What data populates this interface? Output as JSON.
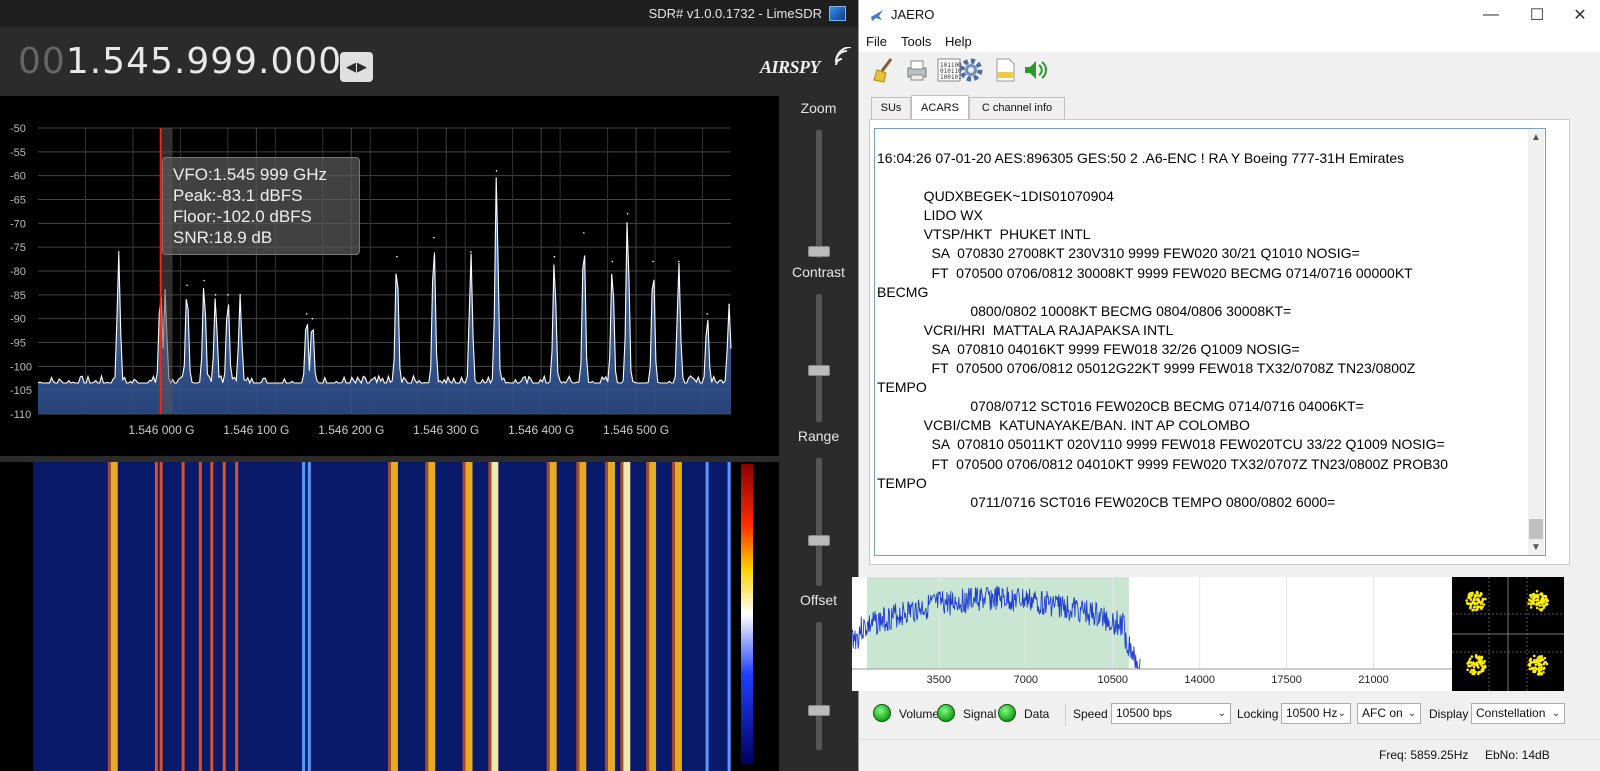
{
  "sdr": {
    "title": "SDR# v1.0.0.1732 - LimeSDR",
    "freq_dim": "00",
    "freq_main": "1.545.999.000",
    "logo": "AIRSPY",
    "vfo_info": {
      "vfo": "VFO:1.545 999 GHz",
      "peak": "Peak:-83.1 dBFS",
      "floor": "Floor:-102.0 dBFS",
      "snr": "SNR:18.9 dB"
    },
    "sliders": [
      {
        "label": "Zoom",
        "value": 0.02
      },
      {
        "label": "Contrast",
        "value": 0.4
      },
      {
        "label": "Range",
        "value": 0.35
      },
      {
        "label": "Offset",
        "value": 0.3
      }
    ],
    "colors": {
      "background": "#2b2b2b",
      "spectrum_fill": "#2e4f8f",
      "spectrum_line": "#ffffff",
      "vfo_line": "#ff2020"
    }
  },
  "jaero": {
    "title": "JAERO",
    "window_controls": [
      "minimize-icon",
      "maximize-icon",
      "close-icon"
    ],
    "menu": [
      "File",
      "Tools",
      "Help"
    ],
    "toolbar_icons": [
      "broom-icon",
      "printer-icon",
      "binary-icon",
      "gear-icon",
      "log-file-icon",
      "speaker-icon"
    ],
    "tabs": [
      {
        "label": "SUs",
        "active": false
      },
      {
        "label": "ACARS",
        "active": true
      },
      {
        "label": "C channel info",
        "active": false
      }
    ],
    "acars_lines": [
      "16:04:26 07-01-20 AES:896305 GES:50 2 .A6-ENC ! RA Y Boeing 777-31H Emirates",
      "",
      "            QUDXBEGEK~1DIS01070904",
      "            LIDO WX",
      "            VTSP/HKT  PHUKET INTL",
      "              SA  070830 27008KT 230V310 9999 FEW020 30/21 Q1010 NOSIG=",
      "              FT  070500 0706/0812 30008KT 9999 FEW020 BECMG 0714/0716 00000KT",
      "BECMG",
      "                        0800/0802 10008KT BECMG 0804/0806 30008KT=",
      "            VCRI/HRI  MATTALA RAJAPAKSA INTL",
      "              SA  070810 04016KT 9999 FEW018 32/26 Q1009 NOSIG=",
      "              FT  070500 0706/0812 05012G22KT 9999 FEW018 TX32/0708Z TN23/0800Z",
      "TEMPO",
      "                        0708/0712 SCT016 FEW020CB BECMG 0714/0716 04006KT=",
      "            VCBI/CMB  KATUNAYAKE/BAN. INT AP COLOMBO",
      "              SA  070810 05011KT 020V110 9999 FEW018 FEW020TCU 33/22 Q1009 NOSIG=",
      "              FT  070500 0706/0812 04010KT 9999 FEW020 TX32/0707Z TN23/0800Z PROB30",
      "TEMPO",
      "                        0711/0716 SCT016 FEW020CB TEMPO 0800/0802 6000="
    ],
    "controls": {
      "volume": "Volume",
      "signal": "Signal",
      "data": "Data",
      "speed_label": "Speed",
      "speed_value": "10500 bps",
      "locking_label": "Locking",
      "locking_value": "10500 Hz",
      "afc_value": "AFC on",
      "display_label": "Display",
      "display_value": "Constellation"
    },
    "status": {
      "freq": "Freq: 5859.25Hz",
      "ebno": "EbNo: 14dB"
    },
    "colors": {
      "led": "#22c022",
      "spectrum_line": "#1f3fd1",
      "passband": "#c8e6d2",
      "constellation": "#ffee00"
    }
  },
  "chart_data": [
    {
      "type": "line",
      "x": [
        1.54595,
        1.54596,
        1.54597,
        1.54598,
        1.54599,
        1.546,
        1.54601,
        1.54602,
        1.54603,
        1.54604,
        1.54605,
        1.54606,
        1.54607,
        1.54608,
        1.54609,
        1.5461,
        1.54611,
        1.54612,
        1.54613,
        1.54614,
        1.54615,
        1.54616,
        1.54617,
        1.54618,
        1.54619,
        1.5462,
        1.54621,
        1.54622,
        1.54623,
        1.54624,
        1.54625,
        1.54626,
        1.54627,
        1.54628,
        1.54629,
        1.5463,
        1.54631,
        1.54632,
        1.54633,
        1.54634,
        1.54635,
        1.54636,
        1.54637,
        1.54638,
        1.54639,
        1.5464,
        1.54641,
        1.54642,
        1.54643,
        1.54644,
        1.54645,
        1.54646,
        1.54647,
        1.54648,
        1.54649,
        1.5465,
        1.54651,
        1.54652,
        1.54653,
        1.54654,
        1.54655,
        1.54656,
        1.54657,
        1.54658,
        1.54659
      ],
      "series": [
        {
          "values": [
            -104,
            -103,
            -103,
            -104,
            -103,
            -103,
            -103,
            -103,
            -103,
            -103,
            -103,
            -103,
            -103,
            -103,
            -104,
            -103,
            -103,
            -103,
            -103,
            -103,
            -103,
            -103,
            -103,
            -103,
            -103,
            -103,
            -103,
            -103,
            -103,
            -103,
            -103,
            -103,
            -103,
            -103,
            -103,
            -103,
            -103,
            -103,
            -103,
            -103,
            -103,
            -103,
            -103,
            -103,
            -103,
            -103,
            -103,
            -103,
            -103,
            -103,
            -103,
            -103,
            -103,
            -103,
            -103,
            -103,
            -103,
            -103,
            -103,
            -103,
            -103,
            -103,
            -103,
            -103,
            -103
          ]
        }
      ],
      "peaks": [
        {
          "x": 1.545955,
          "y": -76
        },
        {
          "x": 1.545999,
          "y": -83.1
        },
        {
          "x": 1.546004,
          "y": -84
        },
        {
          "x": 1.546027,
          "y": -83
        },
        {
          "x": 1.546045,
          "y": -82
        },
        {
          "x": 1.546057,
          "y": -85
        },
        {
          "x": 1.54607,
          "y": -85
        },
        {
          "x": 1.546083,
          "y": -85
        },
        {
          "x": 1.546153,
          "y": -89
        },
        {
          "x": 1.546159,
          "y": -90
        },
        {
          "x": 1.546248,
          "y": -77
        },
        {
          "x": 1.546287,
          "y": -73
        },
        {
          "x": 1.546326,
          "y": -76
        },
        {
          "x": 1.546353,
          "y": -59
        },
        {
          "x": 1.546414,
          "y": -77
        },
        {
          "x": 1.546445,
          "y": -72
        },
        {
          "x": 1.546475,
          "y": -78
        },
        {
          "x": 1.546491,
          "y": -68
        },
        {
          "x": 1.546518,
          "y": -78
        },
        {
          "x": 1.546545,
          "y": -78
        },
        {
          "x": 1.546575,
          "y": -89
        },
        {
          "x": 1.546598,
          "y": -87
        }
      ],
      "ylim": [
        -110,
        -50
      ],
      "yticks": [
        "-50",
        "-55",
        "-60",
        "-65",
        "-70",
        "-75",
        "-80",
        "-85",
        "-90",
        "-95",
        "-100",
        "-105",
        "-110"
      ],
      "xticks": [
        "1.546 000 G",
        "1.546 100 G",
        "1.546 200 G",
        "1.546 300 G",
        "1.546 400 G",
        "1.546 500 G"
      ],
      "xtick_values": [
        1.546,
        1.5461,
        1.5462,
        1.5463,
        1.5464,
        1.5465
      ],
      "xlim": [
        1.54587,
        1.5466
      ],
      "grid": true
    },
    {
      "type": "line",
      "xticks": [
        "3500",
        "7000",
        "10500",
        "14000",
        "17500",
        "21000"
      ],
      "xtick_values": [
        3500,
        7000,
        10500,
        14000,
        17500,
        21000
      ],
      "xlim": [
        0,
        24000
      ],
      "ylim": [
        0,
        1
      ],
      "passband": [
        600,
        11150
      ],
      "grid": true
    }
  ]
}
